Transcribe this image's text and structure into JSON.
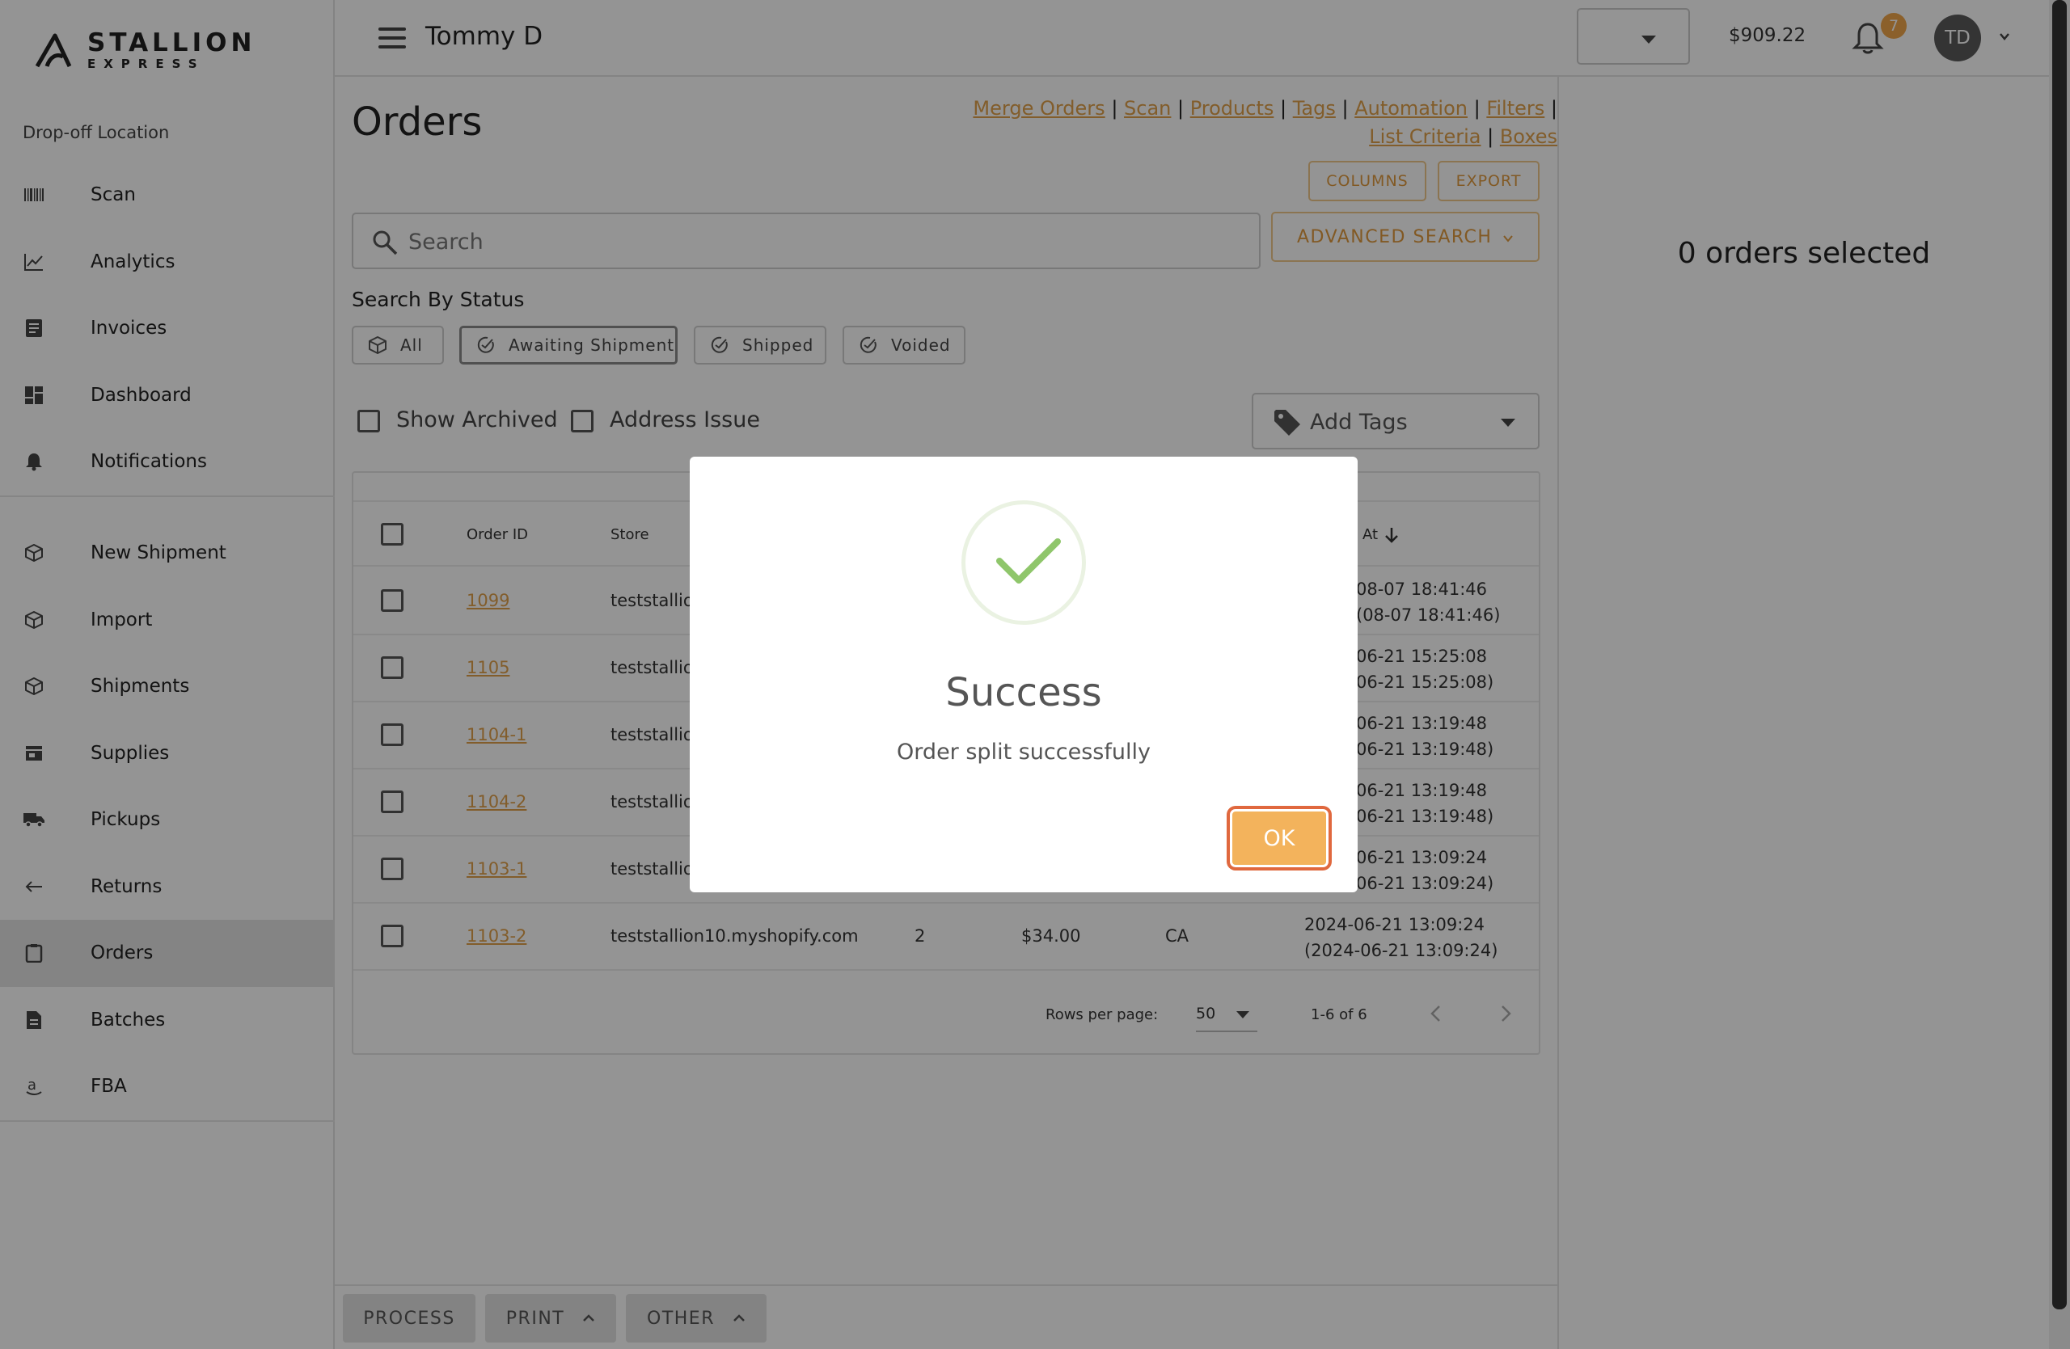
{
  "brand": {
    "line1": "STALLION",
    "line2": "EXPRESS"
  },
  "sidebar": {
    "dropoff_label": "Drop-off Location",
    "group1": [
      {
        "label": "Scan",
        "icon": "barcode-icon"
      },
      {
        "label": "Analytics",
        "icon": "chart-line-icon"
      },
      {
        "label": "Invoices",
        "icon": "invoice-icon"
      },
      {
        "label": "Dashboard",
        "icon": "dashboard-icon"
      },
      {
        "label": "Notifications",
        "icon": "bell-icon"
      }
    ],
    "group2": [
      {
        "label": "New Shipment",
        "icon": "box-icon"
      },
      {
        "label": "Import",
        "icon": "box-icon"
      },
      {
        "label": "Shipments",
        "icon": "box-icon"
      },
      {
        "label": "Supplies",
        "icon": "store-icon"
      },
      {
        "label": "Pickups",
        "icon": "truck-icon"
      },
      {
        "label": "Returns",
        "icon": "arrow-left-icon"
      },
      {
        "label": "Orders",
        "icon": "clipboard-icon",
        "active": true
      },
      {
        "label": "Batches",
        "icon": "document-icon"
      },
      {
        "label": "FBA",
        "icon": "amazon-icon"
      }
    ]
  },
  "topbar": {
    "user_name": "Tommy D",
    "balance": "$909.22",
    "notification_count": "7",
    "avatar_initials": "TD"
  },
  "main": {
    "title": "Orders",
    "quick_links": [
      "Merge Orders",
      "Scan",
      "Products",
      "Tags",
      "Automation",
      "Filters",
      "List Criteria",
      "Boxes"
    ],
    "columns_label": "COLUMNS",
    "export_label": "EXPORT",
    "search_placeholder": "Search",
    "advanced_search_label": "ADVANCED SEARCH",
    "status_title": "Search By Status",
    "status_filters": [
      {
        "label": "All",
        "active": false
      },
      {
        "label": "Awaiting Shipment",
        "active": true
      },
      {
        "label": "Shipped",
        "active": false
      },
      {
        "label": "Voided",
        "active": false
      }
    ],
    "show_archived_label": "Show Archived",
    "address_issue_label": "Address Issue",
    "add_tags_label": "Add Tags"
  },
  "table": {
    "headers": {
      "order_id": "Order ID",
      "store": "Store",
      "created_at": "At"
    },
    "rows": [
      {
        "order_id": "1099",
        "store": "teststallion",
        "date": "08-07 18:41:46",
        "date2": "(08-07 18:41:46)"
      },
      {
        "order_id": "1105",
        "store": "teststallion",
        "date": "06-21 15:25:08",
        "date2": "06-21 15:25:08)"
      },
      {
        "order_id": "1104-1",
        "store": "teststallion",
        "date": "06-21 13:19:48",
        "date2": "06-21 13:19:48)"
      },
      {
        "order_id": "1104-2",
        "store": "teststallion",
        "date": "06-21 13:19:48",
        "date2": "06-21 13:19:48)"
      },
      {
        "order_id": "1103-1",
        "store": "teststallion",
        "date": "06-21 13:09:24",
        "date2": "06-21 13:09:24)"
      },
      {
        "order_id": "1103-2",
        "store": "teststallion10.myshopify.com",
        "qty": "2",
        "total": "$34.00",
        "country": "CA",
        "date": "2024-06-21 13:09:24",
        "date2": "(2024-06-21 13:09:24)"
      }
    ],
    "rows_per_page_label": "Rows per page:",
    "rows_per_page": "50",
    "range": "1-6 of 6"
  },
  "bottom_bar": {
    "process": "PROCESS",
    "print": "PRINT",
    "other": "OTHER"
  },
  "right_panel": {
    "selected_text": "0 orders selected"
  },
  "modal": {
    "title": "Success",
    "message": "Order split successfully",
    "ok_label": "OK"
  },
  "colors": {
    "accent": "#e0a04a",
    "success": "#8fc66b",
    "ok_button": "#f3b35c"
  }
}
